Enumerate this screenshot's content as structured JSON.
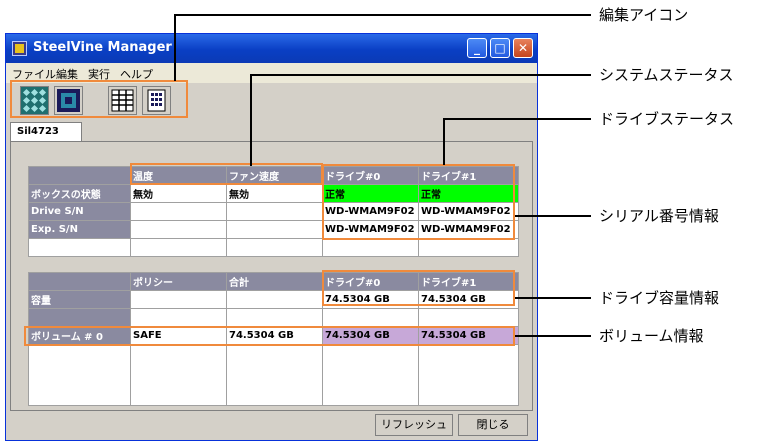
{
  "window": {
    "title": "SteelVine Manager",
    "minimize": "_",
    "maximize": "□",
    "close": "✕"
  },
  "menu": [
    "ファイル",
    "編集",
    "実行",
    "ヘルプ"
  ],
  "toolbar_icons": [
    "array-grid-icon",
    "drive-box-icon",
    "table-view-icon",
    "chip-icon"
  ],
  "tab": {
    "label": "Sil4723"
  },
  "status_table": {
    "columns": [
      "温度",
      "ファン速度",
      "ドライブ#0",
      "ドライブ#1"
    ],
    "rows": [
      {
        "label": "ボックスの状態",
        "cells": [
          "無効",
          "無効",
          "正常",
          "正常"
        ]
      },
      {
        "label": "Drive S/N",
        "cells": [
          "",
          "",
          "WD-WMAM9F02",
          "WD-WMAM9F02"
        ]
      },
      {
        "label": "Exp. S/N",
        "cells": [
          "",
          "",
          "WD-WMAM9F02",
          "WD-WMAM9F02"
        ]
      }
    ]
  },
  "volume_table": {
    "columns": [
      "ポリシー",
      "合計",
      "ドライブ#0",
      "ドライブ#1"
    ],
    "rows": [
      {
        "label": "容量",
        "cells": [
          "",
          "",
          "74.5304 GB",
          "74.5304 GB"
        ]
      },
      {
        "label": "",
        "cells": [
          "",
          "",
          "",
          ""
        ]
      },
      {
        "label": "ボリューム # 0",
        "cells": [
          "SAFE",
          "74.5304 GB",
          "74.5304 GB",
          "74.5304 GB"
        ]
      }
    ]
  },
  "buttons": {
    "refresh": "リフレッシュ",
    "close": "閉じる"
  },
  "callouts": {
    "edit_icons": "編集アイコン",
    "system_status": "システムステータス",
    "drive_status": "ドライブステータス",
    "serial_info": "シリアル番号情報",
    "drive_capacity": "ドライブ容量情報",
    "volume_info": "ボリューム情報"
  },
  "colors": {
    "accent_highlight": "#f08a3c",
    "ok_green": "#00ff00",
    "volume_purple": "#c7a8d8",
    "header_gray": "#8a8aa0"
  }
}
